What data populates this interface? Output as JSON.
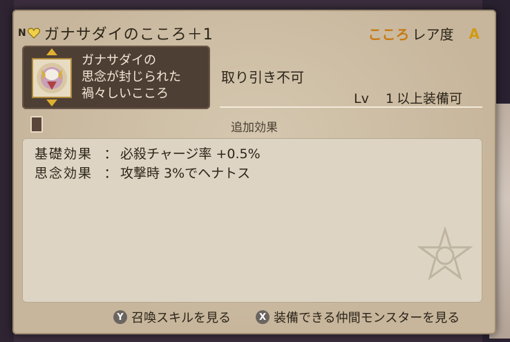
{
  "header": {
    "rank": "N",
    "title": "ガナサダイのこころ＋1",
    "rarity_word": "こころ",
    "rarity_label": "レア度",
    "rarity_grade": "A"
  },
  "description": {
    "text": "ガナサダイの\n思念が封じられた\n禍々しいこころ"
  },
  "trade_status": "取り引き不可",
  "level": {
    "label": "Lv",
    "value": "1",
    "suffix": "以上装備可"
  },
  "bonus_header": "追加効果",
  "effects": [
    {
      "label": "基礎効果",
      "colon": "：",
      "value": "必殺チャージ率 +0.5%"
    },
    {
      "label": "思念効果",
      "colon": "：",
      "value": "攻撃時 3%でヘナトス"
    }
  ],
  "footer": {
    "buttons": [
      {
        "icon": "Y",
        "label": "召喚スキルを見る"
      },
      {
        "icon": "X",
        "label": "装備できる仲間モンスターを見る"
      }
    ]
  },
  "colors": {
    "parchment": "#c7b69c",
    "accent_orange": "#c77a12",
    "grade_gold": "#d09a14",
    "desc_box": "#4e3f35"
  },
  "icons": [
    "heart-icon",
    "portrait-icon",
    "book-icon",
    "emblem-icon",
    "y-button-icon",
    "x-button-icon"
  ]
}
